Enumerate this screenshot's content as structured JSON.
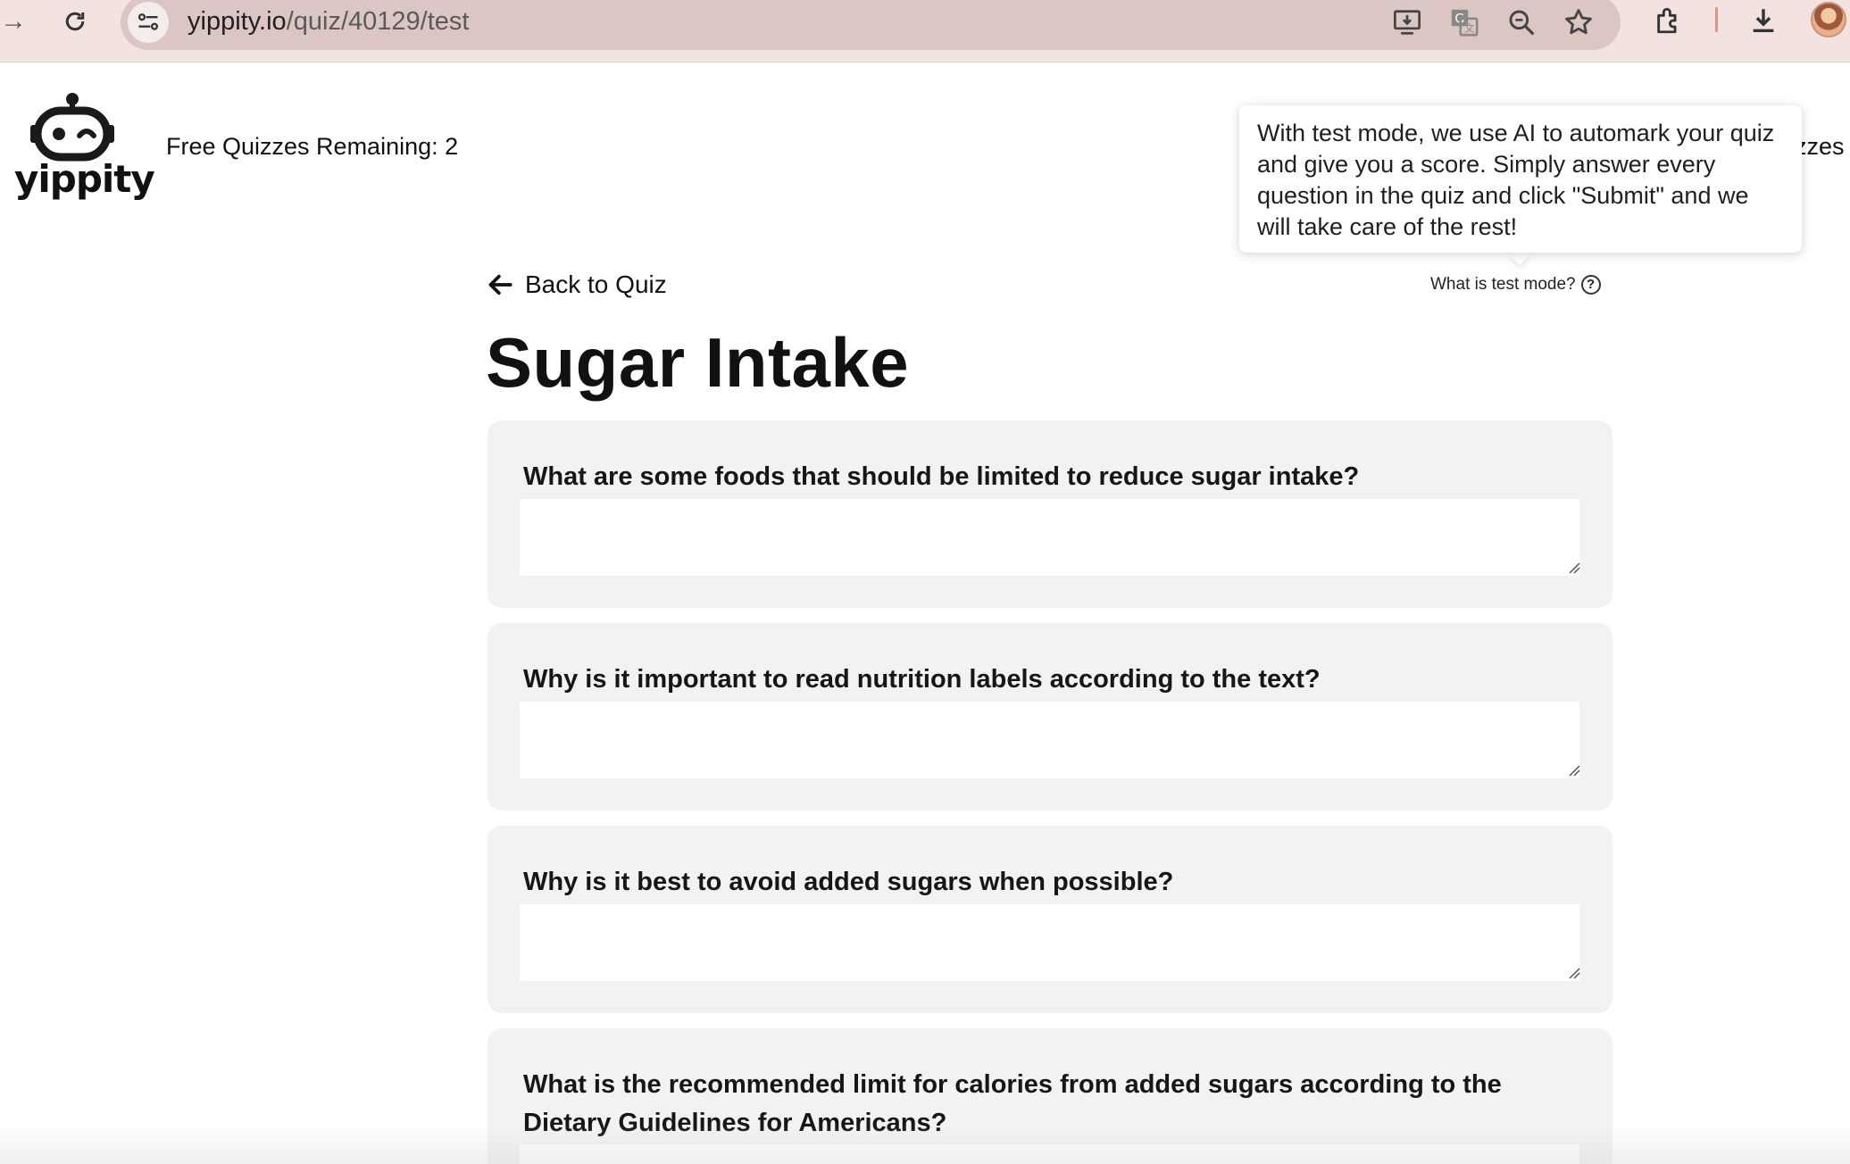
{
  "browser": {
    "url_host": "yippity.io",
    "url_path": "/quiz/40129/test",
    "icons": [
      "forward-arrow-icon",
      "reload-icon",
      "site-settings-icon",
      "install-app-icon",
      "translate-icon",
      "zoom-icon",
      "bookmark-star-icon",
      "extensions-icon",
      "download-icon",
      "profile-avatar"
    ]
  },
  "header": {
    "logo_text": "yippity",
    "free_quizzes": "Free Quizzes Remaining: 2",
    "right_nav_partial": "zzes"
  },
  "tooltip": {
    "text": "With test mode, we use AI to automark your quiz and give you a score. Simply answer every question in the quiz and click \"Submit\" and we will take care of the rest!"
  },
  "quiz": {
    "back_label": "Back to Quiz",
    "test_mode_label": "What is test mode?",
    "help_symbol": "?",
    "title": "Sugar Intake",
    "questions": [
      {
        "text": "What are some foods that should be limited to reduce sugar intake?",
        "answer": ""
      },
      {
        "text": "Why is it important to read nutrition labels according to the text?",
        "answer": ""
      },
      {
        "text": "Why is it best to avoid added sugars when possible?",
        "answer": ""
      },
      {
        "text": "What is the recommended limit for calories from added sugars according to the Dietary Guidelines for Americans?",
        "answer": ""
      }
    ]
  },
  "colors": {
    "browser_bar": "#f2e3e0",
    "omnibox": "#dcc6c3",
    "card": "#f2f2f2",
    "text": "#111111"
  }
}
